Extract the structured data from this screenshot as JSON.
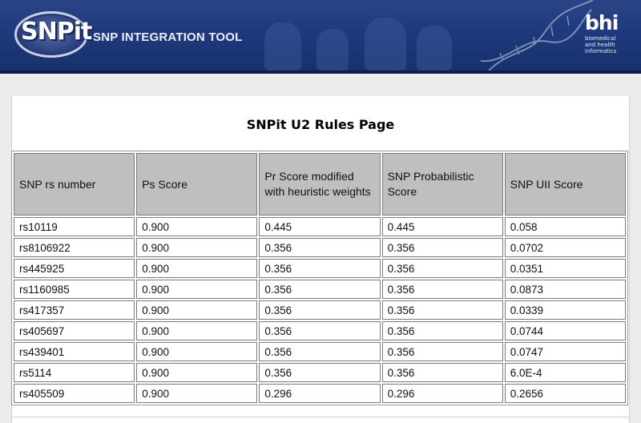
{
  "header": {
    "logo_text": "SNPit",
    "tool_title": "SNP INTEGRATION TOOL",
    "brand_logo": "bhi",
    "brand_lines": [
      "biomedical",
      "and health",
      "informatics"
    ]
  },
  "page": {
    "title": "SNPit U2 Rules Page"
  },
  "table": {
    "columns": [
      "SNP rs number",
      "Ps Score",
      "Pr Score modified with heuristic weights",
      "SNP Probabilistic Score",
      "SNP UII Score"
    ],
    "rows": [
      [
        "rs10119",
        "0.900",
        "0.445",
        "0.445",
        "0.058"
      ],
      [
        "rs8106922",
        "0.900",
        "0.356",
        "0.356",
        "0.0702"
      ],
      [
        "rs445925",
        "0.900",
        "0.356",
        "0.356",
        "0.0351"
      ],
      [
        "rs1160985",
        "0.900",
        "0.356",
        "0.356",
        "0.0873"
      ],
      [
        "rs417357",
        "0.900",
        "0.356",
        "0.356",
        "0.0339"
      ],
      [
        "rs405697",
        "0.900",
        "0.356",
        "0.356",
        "0.0744"
      ],
      [
        "rs439401",
        "0.900",
        "0.356",
        "0.356",
        "0.0747"
      ],
      [
        "rs5114",
        "0.900",
        "0.356",
        "0.356",
        "6.0E-4"
      ],
      [
        "rs405509",
        "0.900",
        "0.296",
        "0.296",
        "0.2656"
      ]
    ]
  },
  "colors": {
    "banner": "#1f3a7c",
    "header_cell": "#bfbfbf",
    "page_background": "#ebebeb"
  }
}
